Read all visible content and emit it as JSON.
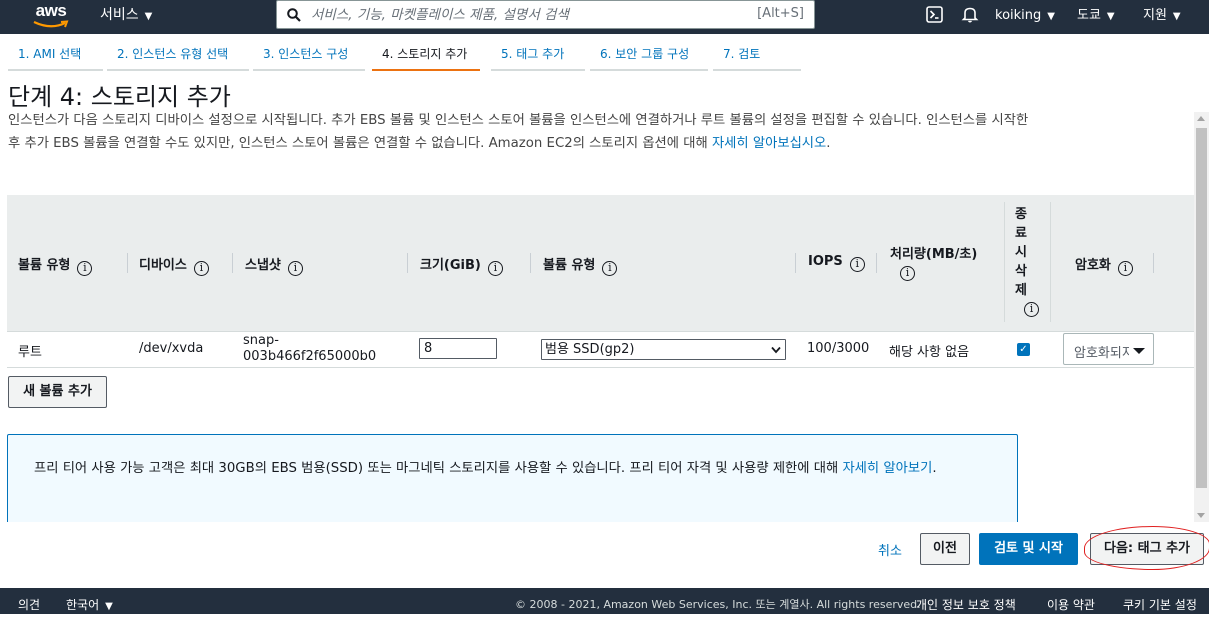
{
  "topnav": {
    "logo": "aws",
    "services_label": "서비스",
    "search_placeholder": "서비스, 기능, 마켓플레이스 제품, 설명서 검색",
    "search_shortcut": "[Alt+S]",
    "user": "koiking",
    "region": "도쿄",
    "support": "지원"
  },
  "tabs": [
    {
      "label": "1. AMI 선택"
    },
    {
      "label": "2. 인스턴스 유형 선택"
    },
    {
      "label": "3. 인스턴스 구성"
    },
    {
      "label": "4. 스토리지 추가"
    },
    {
      "label": "5. 태그 추가"
    },
    {
      "label": "6. 보안 그룹 구성"
    },
    {
      "label": "7. 검토"
    }
  ],
  "page": {
    "title": "단계 4: 스토리지 추가",
    "desc_text": "인스턴스가 다음 스토리지 디바이스 설정으로 시작됩니다. 추가 EBS 볼륨 및 인스턴스 스토어 볼륨을 인스턴스에 연결하거나 루트 볼륨의 설정을 편집할 수 있습니다. 인스턴스를 시작한 후 추가 EBS 볼륨을 연결할 수도 있지만, 인스턴스 스토어 볼륨은 연결할 수 없습니다. Amazon EC2의 스토리지 옵션에 대해 ",
    "desc_link": "자세히 알아보십시오",
    "desc_end": "."
  },
  "table": {
    "headers": {
      "volume_type": "볼륨 유형",
      "device": "디바이스",
      "snapshot": "스냅샷",
      "size": "크기(GiB)",
      "volume_kind": "볼륨 유형",
      "iops": "IOPS",
      "throughput": "처리량(MB/초)",
      "delete_on_term": "종료시삭제",
      "encryption": "암호화"
    },
    "info_glyph": "i",
    "row": {
      "volume_type": "루트",
      "device": "/dev/xvda",
      "snapshot_1": "snap-",
      "snapshot_2": "003b466f2f65000b0",
      "size": "8",
      "volume_kind": "범용 SSD(gp2)",
      "iops": "100/3000",
      "throughput": "해당 사항 없음",
      "delete_on_term": true,
      "encryption": "암호화되지 않음"
    }
  },
  "buttons": {
    "add_volume": "새 볼륨 추가",
    "cancel": "취소",
    "previous": "이전",
    "review_launch": "검토 및 시작",
    "next": "다음: 태그 추가"
  },
  "infobox": {
    "text": "프리 티어 사용 가능 고객은 최대 30GB의 EBS 범용(SSD) 또는 마그네틱 스토리지를 사용할 수 있습니다. 프리 티어 자격 및 사용량 제한에 대해 ",
    "link": "자세히 알아보기",
    "end": "."
  },
  "footer": {
    "feedback": "의견",
    "language": "한국어",
    "copyright": "© 2008 - 2021, Amazon Web Services, Inc. 또는 계열사. All rights reserved.",
    "privacy": "개인 정보 보호 정책",
    "terms": "이용 약관",
    "cookies": "쿠키 기본 설정"
  },
  "colors": {
    "nav_bg": "#232f3e",
    "link": "#0073bb",
    "active_tab": "#ec7211",
    "primary_button": "#0073bb",
    "annotation": "#e02020"
  }
}
